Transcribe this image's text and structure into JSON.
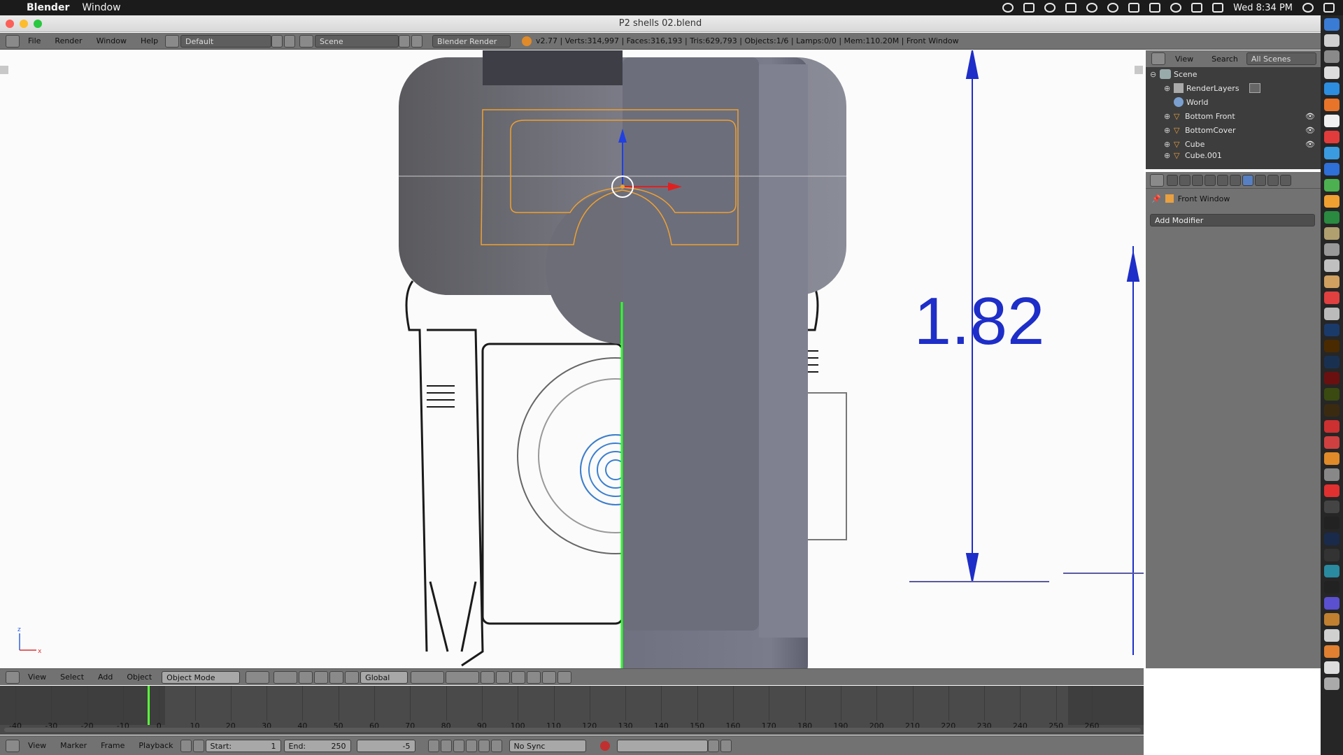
{
  "mac_menubar": {
    "app_name": "Blender",
    "menu_items": [
      "Window"
    ],
    "clock": "Wed 8:34 PM"
  },
  "window": {
    "title": "P2 shells 02.blend"
  },
  "info_header": {
    "menus": [
      "File",
      "Render",
      "Window",
      "Help"
    ],
    "layout_name": "Default",
    "scene_name": "Scene",
    "render_engine": "Blender Render",
    "stats": "v2.77 | Verts:314,997 | Faces:316,193 | Tris:629,793 | Objects:1/6 | Lamps:0/0 | Mem:110.20M | Front Window"
  },
  "viewport": {
    "dimension_label": "1.82",
    "axis_z": "z",
    "axis_x": "x"
  },
  "outliner": {
    "menus": [
      "View",
      "Search"
    ],
    "filter": "All Scenes",
    "items": [
      {
        "label": "Scene",
        "icon": "scene-icon"
      },
      {
        "label": "RenderLayers",
        "icon": "renderlayers-icon"
      },
      {
        "label": "World",
        "icon": "world-icon"
      },
      {
        "label": "Bottom Front",
        "icon": "mesh-icon"
      },
      {
        "label": "BottomCover",
        "icon": "mesh-icon"
      },
      {
        "label": "Cube",
        "icon": "mesh-icon"
      },
      {
        "label": "Cube.001",
        "icon": "mesh-icon"
      }
    ]
  },
  "properties": {
    "context_object": "Front Window",
    "add_modifier": "Add Modifier"
  },
  "view3d_header": {
    "menus": [
      "View",
      "Select",
      "Add",
      "Object"
    ],
    "mode": "Object Mode",
    "orientation": "Global"
  },
  "timeline": {
    "ruler_labels": [
      "-40",
      "-30",
      "-20",
      "-10",
      "0",
      "10",
      "20",
      "30",
      "40",
      "50",
      "60",
      "70",
      "80",
      "90",
      "100",
      "110",
      "120",
      "130",
      "140",
      "150",
      "160",
      "170",
      "180",
      "190",
      "200",
      "210",
      "220",
      "230",
      "240",
      "250",
      "260"
    ],
    "current_frame": 1,
    "menus": [
      "View",
      "Marker",
      "Frame",
      "Playback"
    ],
    "start_label": "Start:",
    "start": "1",
    "end_label": "End:",
    "end": "250",
    "frame": "-5",
    "sync": "No Sync"
  },
  "colors": {
    "ui_gray": "#727272",
    "dark_panel": "#3d3d3d",
    "selection_orange": "#f0a030",
    "blueprint_blue": "#1e2ec8",
    "model_gray": "#7a7c8a"
  }
}
